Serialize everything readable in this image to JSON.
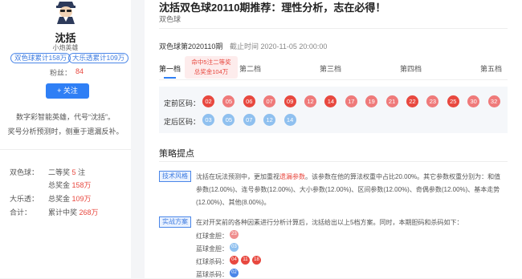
{
  "profile": {
    "name": "沈括",
    "subtitle": "小炮英雄",
    "tags": [
      "双色球累计158万",
      "大乐透累计109万"
    ],
    "fans_label": "粉丝：",
    "fans_count": "84",
    "follow_label": "+ 关注",
    "desc_line1": "数字彩智能英雄，代号“沈括”。",
    "desc_line2": "奖号分析预测时，侧重于遗漏反补。"
  },
  "stats": {
    "r1_label": "双色球：",
    "r1_text": "二等奖",
    "r1_num": "5",
    "r1_unit": "注",
    "r2_text": "总奖金",
    "r2_amount": "158万",
    "r3_label": "大乐透：",
    "r3_text": "总奖金",
    "r3_amount": "109万",
    "r4_label": "合计：",
    "r4_text": "累计中奖",
    "r4_amount": "268万"
  },
  "article": {
    "title": "沈括双色球20110期推荐：理性分析，志在必得！",
    "category": "双色球",
    "issue": "双色球第2020110期",
    "deadline": "截止时间 2020-11-05 20:00:00"
  },
  "tabs": [
    "第一档",
    "第二档",
    "第三档",
    "第四档",
    "第五档"
  ],
  "tooltip": {
    "line1": "命中5注二等奖",
    "line2": "总奖金104万"
  },
  "balls": {
    "front_label": "定前区码：",
    "front": [
      "02",
      "05",
      "06",
      "07",
      "09",
      "12",
      "14",
      "17",
      "19",
      "21",
      "22",
      "23",
      "25",
      "30",
      "32"
    ],
    "back_label": "定后区码：",
    "back": [
      "03",
      "05",
      "07",
      "12",
      "14"
    ]
  },
  "strategy": {
    "heading": "策略提点",
    "tech_tag": "技术风格",
    "tech_line1_a": "沈括在玩法预测中，更加重视",
    "tech_line1_b": "遗漏参数",
    "tech_line1_c": "。该参数在他的算法权重中占比20.00%。其它参数权重分别为：和值",
    "tech_line2": "参数(12.00%)、连号参数(12.00%)、大小参数(12.00%)、区间参数(12.00%)、奇偶参数(12.00%)、基本走势",
    "tech_line3": "(12.00%)、其他(8.00%)。",
    "plan_tag": "实战方案",
    "plan_line": "在对开奖前的各种因素进行分析计算后，沈括给出以上5档方案。同时，本期胆码和杀码如下：",
    "red_dan_label": "红球金胆：",
    "red_dan": [
      "23"
    ],
    "blue_dan_label": "蓝球金胆：",
    "blue_dan": [
      "03"
    ],
    "red_kill_label": "红球杀码：",
    "red_kill": [
      "04",
      "11",
      "18"
    ],
    "blue_kill_label": "蓝球杀码：",
    "blue_kill": [
      "02"
    ]
  }
}
